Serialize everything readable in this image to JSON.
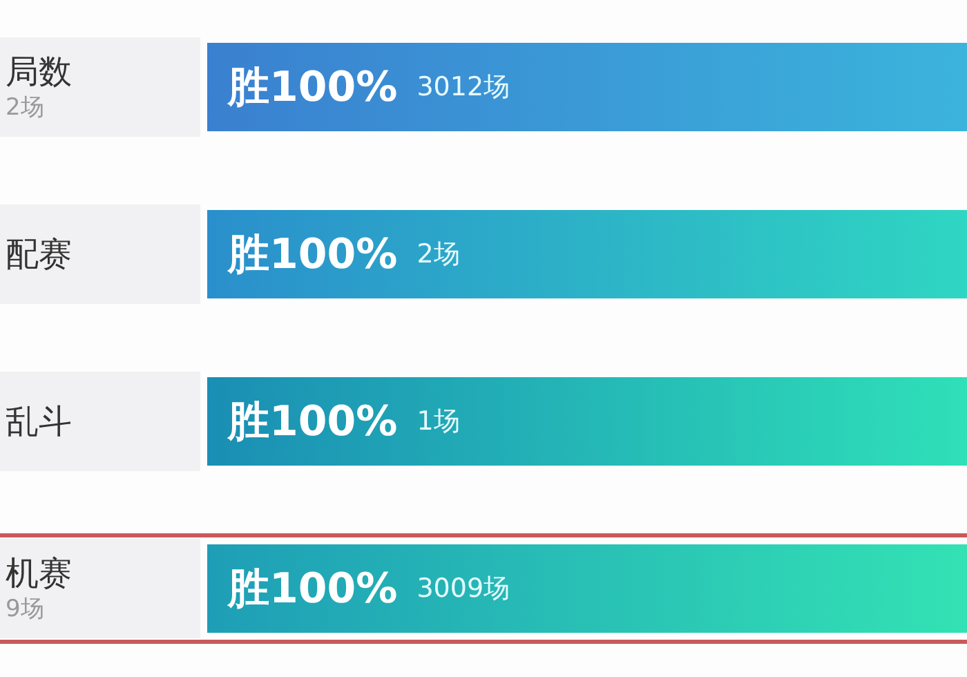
{
  "rows": [
    {
      "label": "局数",
      "sublabel": "2场",
      "win": "胜100%",
      "count": "3012场",
      "selected": false
    },
    {
      "label": "配赛",
      "win": "胜100%",
      "count": "2场",
      "selected": false
    },
    {
      "label": "乱斗",
      "win": "胜100%",
      "count": "1场",
      "selected": false
    },
    {
      "label": "机赛",
      "sublabel": "9场",
      "win": "胜100%",
      "count": "3009场",
      "selected": true
    }
  ]
}
